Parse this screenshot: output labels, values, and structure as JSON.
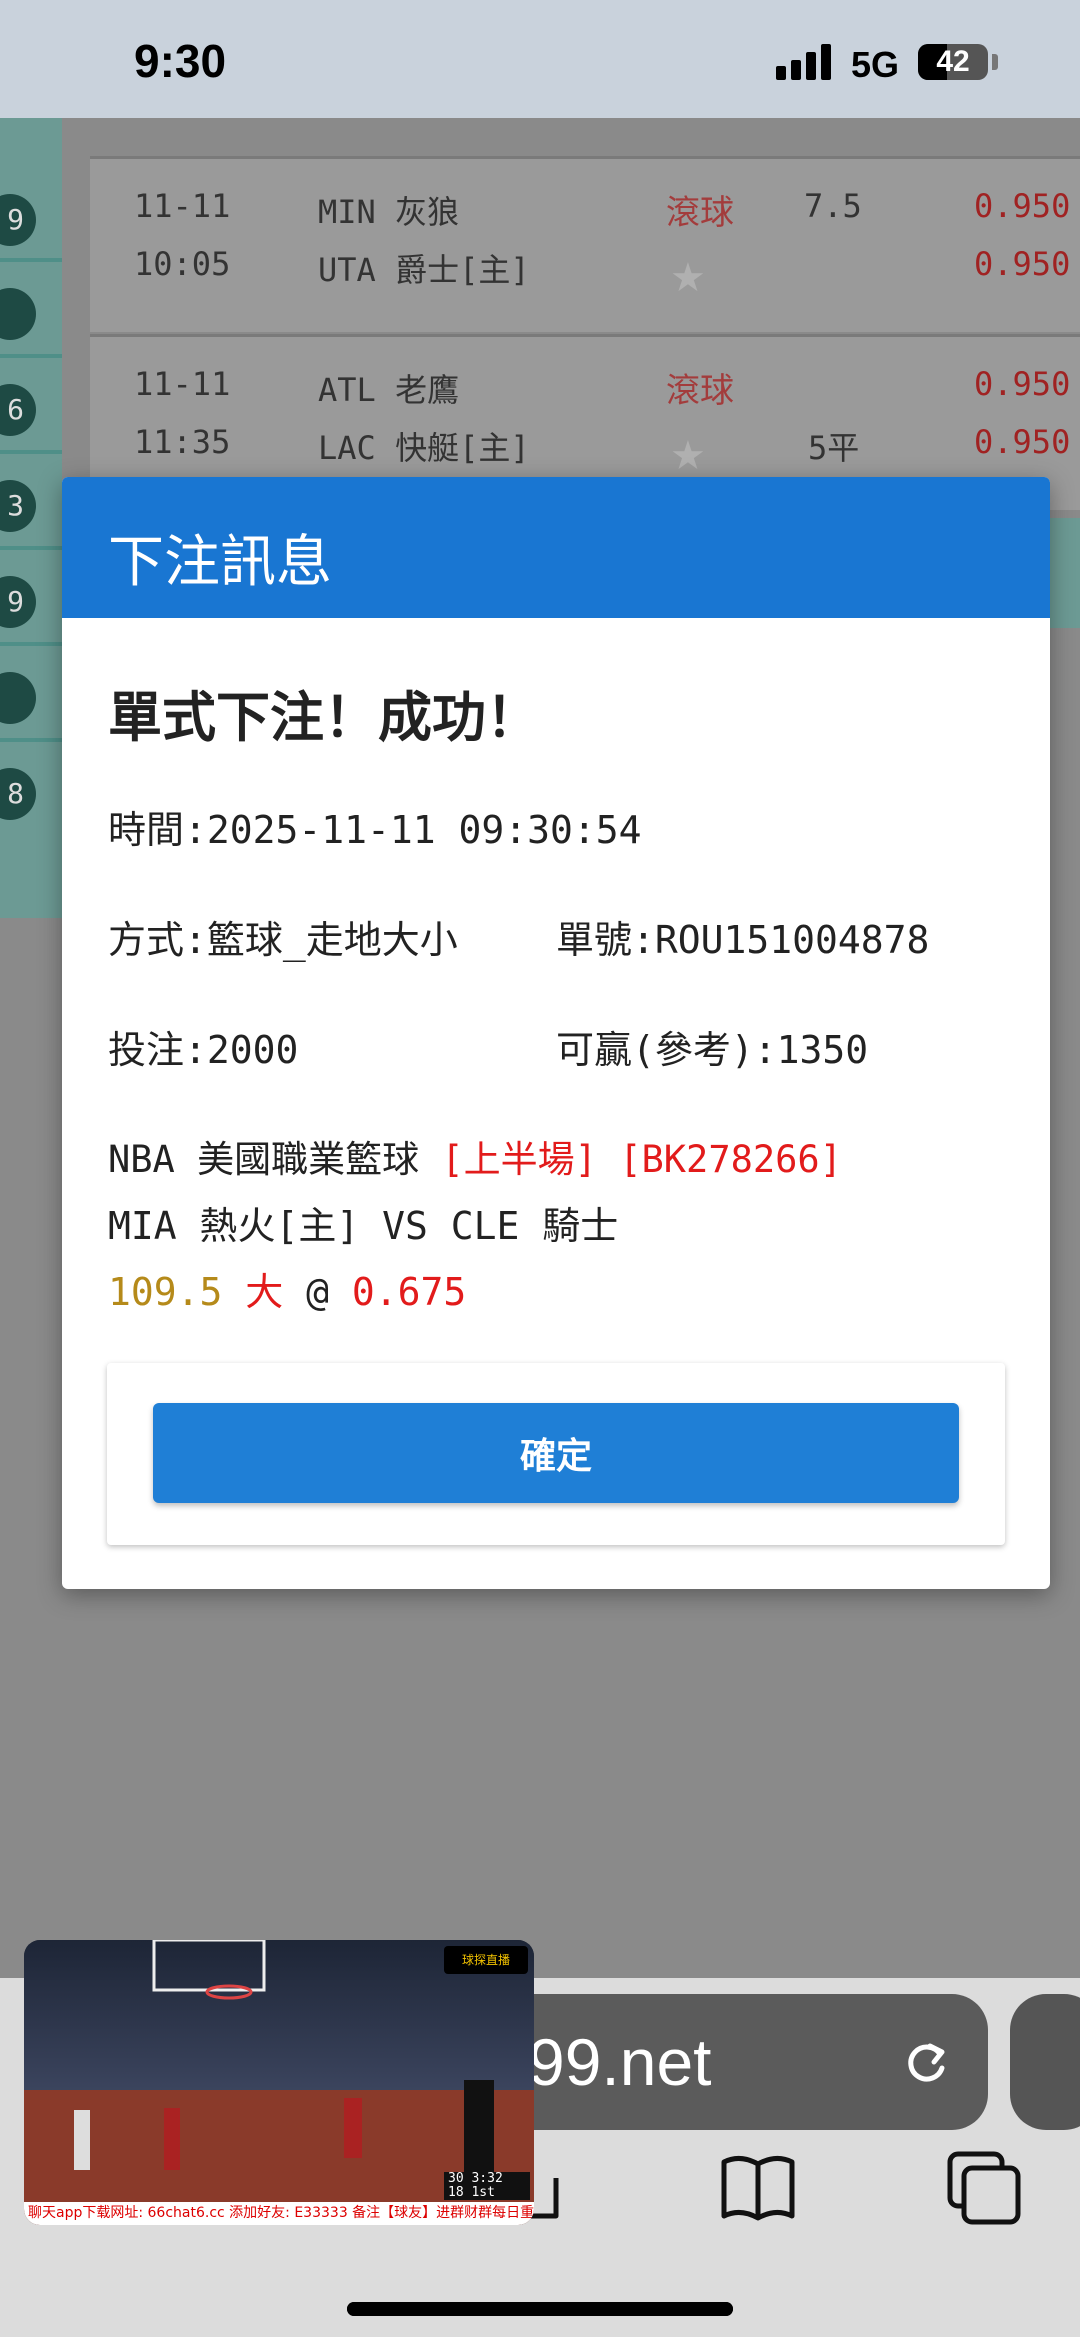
{
  "status_bar": {
    "time": "9:30",
    "network": "5G",
    "battery": "42",
    "battery_level_percent": 42
  },
  "background": {
    "side_badges": [
      "9",
      "6",
      "3",
      "9",
      "",
      "",
      "8"
    ],
    "matches": [
      {
        "date": "11-11",
        "time": "10:05",
        "away": "MIN 灰狼",
        "home": "UTA 爵士[主]",
        "live": "滾球",
        "line": "7.5",
        "odds_top": "0.950",
        "odds_bottom": "0.950"
      },
      {
        "date": "11-11",
        "time": "11:35",
        "away": "ATL 老鷹",
        "home": "LAC 快艇[主]",
        "live": "滾球",
        "line": "5平",
        "odds_top": "0.950",
        "odds_bottom": "0.950"
      }
    ]
  },
  "modal": {
    "title": "下注訊息",
    "success": "單式下注！成功！",
    "time": "時間:2025-11-11 09:30:54",
    "method": "方式:籃球_走地大小",
    "ticket": "單號:ROU151004878",
    "stake": "投注:2000",
    "win": "可贏(參考):1350",
    "league": "NBA 美國職業籃球 ",
    "period": "[上半場]",
    "code": " [BK278266]",
    "matchup": "MIA 熱火[主] VS CLE 騎士",
    "line_value": "109.5",
    "selection": " 大",
    "at": " @ ",
    "odds": "0.675",
    "confirm": "確定"
  },
  "browser": {
    "url": "99.net"
  },
  "pip": {
    "ticker": "聊天app下载网址: 66chat6.cc  添加好友: E33333  备注【球友】进群财群每日重磅推车",
    "logo": "球探直播",
    "score_home": "30",
    "score_away": "18",
    "clock": "3:32",
    "period": "1st"
  },
  "colors": {
    "header": "#1976d2",
    "button": "#1f7fd6",
    "highlight_red": "#e21b1b",
    "line_gold": "#b58a1a"
  }
}
